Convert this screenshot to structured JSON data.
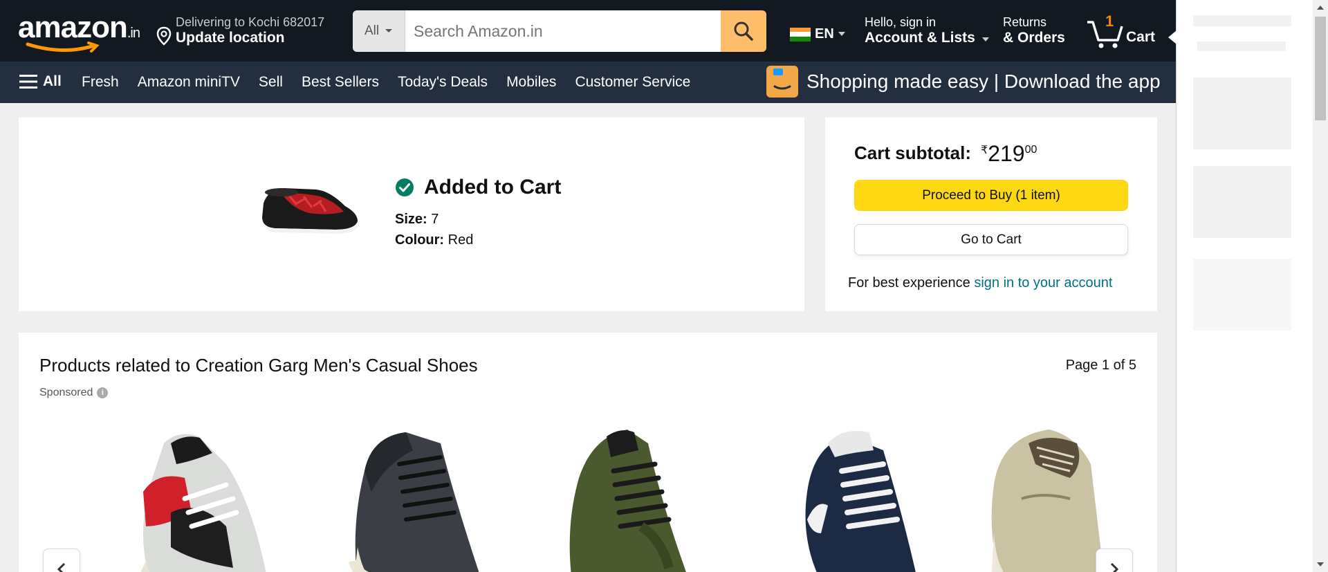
{
  "header": {
    "logo_text": "amazon",
    "logo_suffix": ".in",
    "location_line1": "Delivering to Kochi 682017",
    "location_line2": "Update location",
    "search_category": "All",
    "search_placeholder": "Search Amazon.in",
    "language": "EN",
    "account_line1": "Hello, sign in",
    "account_line2": "Account & Lists",
    "orders_line1": "Returns",
    "orders_line2": "& Orders",
    "cart_count": "1",
    "cart_label": "Cart"
  },
  "subnav": {
    "all_label": "All",
    "links": [
      "Fresh",
      "Amazon miniTV",
      "Sell",
      "Best Sellers",
      "Today's Deals",
      "Mobiles",
      "Customer Service"
    ],
    "promo_text": "Shopping made easy | Download the app"
  },
  "added": {
    "title": "Added to Cart",
    "size_label": "Size:",
    "size_value": "7",
    "colour_label": "Colour:",
    "colour_value": "Red"
  },
  "subtotal": {
    "label": "Cart subtotal:",
    "currency": "₹",
    "whole": "219",
    "fraction": "00",
    "buy_button": "Proceed to Buy (1 item)",
    "cart_button": "Go to Cart",
    "note": "For best experience ",
    "note_link": "sign in to your account"
  },
  "related": {
    "title": "Products related to Creation Garg Men's Casual Shoes",
    "page": "Page 1 of 5",
    "sponsored": "Sponsored",
    "products": [
      {
        "name": "white-red-sneaker",
        "color": "#c8c8c8"
      },
      {
        "name": "black-high-top",
        "color": "#3b3f45"
      },
      {
        "name": "olive-high-top",
        "color": "#4b5a2e"
      },
      {
        "name": "navy-sneaker",
        "color": "#1d2a44"
      },
      {
        "name": "khaki-slip-on",
        "color": "#c9c3a3"
      }
    ]
  },
  "colors": {
    "nav_dark": "#131921",
    "nav_sub": "#232f3e",
    "accent_orange": "#febd69",
    "buy_yellow": "#ffd814",
    "link_teal": "#007185",
    "check_green": "#067d62"
  }
}
